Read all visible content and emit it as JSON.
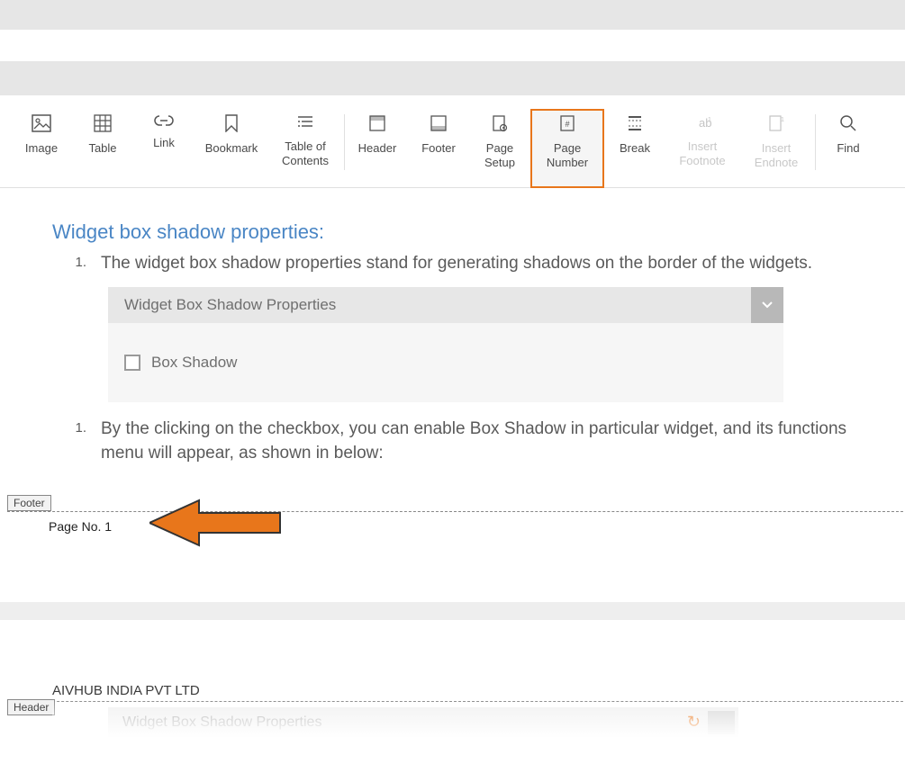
{
  "ribbon": {
    "image": "Image",
    "table": "Table",
    "link": "Link",
    "bookmark": "Bookmark",
    "toc": "Table of\nContents",
    "header": "Header",
    "footer": "Footer",
    "pagesetup": "Page\nSetup",
    "pagenumber": "Page\nNumber",
    "break": "Break",
    "footnote": "Insert\nFootnote",
    "endnote": "Insert\nEndnote",
    "find": "Find"
  },
  "content": {
    "heading": "Widget box shadow properties:",
    "item1_num": "1.",
    "item1_text": "The widget box shadow properties stand for generating shadows on the border of the widgets.",
    "panel_title": "Widget Box Shadow Properties",
    "checkbox_label": "Box Shadow",
    "item2_num": "1.",
    "item2_text": "By the clicking on the checkbox, you can enable Box Shadow in particular widget, and its functions menu will appear, as shown in below:"
  },
  "footer": {
    "tab": "Footer",
    "pageno": "Page No. 1"
  },
  "nextpage": {
    "company": "AIVHUB INDIA PVT LTD",
    "header_tab": "Header",
    "panel_title": "Widget Box Shadow Properties"
  }
}
